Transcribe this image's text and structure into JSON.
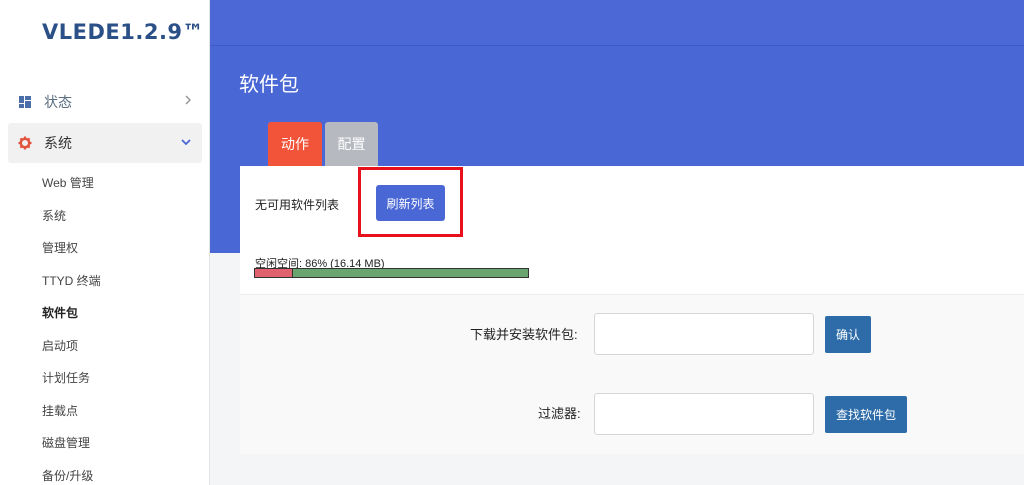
{
  "brand": "VLEDE1.2.9™",
  "sidebar": {
    "items": [
      {
        "label": "状态",
        "icon": "dashboard-icon"
      },
      {
        "label": "系统",
        "icon": "gear-icon"
      }
    ],
    "sub_items": [
      "Web 管理",
      "系统",
      "管理权",
      "TTYD 终端",
      "软件包",
      "启动项",
      "计划任务",
      "挂载点",
      "磁盘管理",
      "备份/升级"
    ],
    "active_sub": "软件包"
  },
  "page": {
    "title": "软件包",
    "tabs": [
      "动作",
      "配置"
    ]
  },
  "actions": {
    "no_packages": "无可用软件列表",
    "refresh_label": "刷新列表",
    "free_space": "空闲空间: 86% (16.14 MB)",
    "free_percent": 86,
    "download_label": "下载并安装软件包:",
    "download_value": "",
    "confirm_label": "确认",
    "filter_label": "过滤器:",
    "filter_value": "",
    "find_label": "查找软件包"
  },
  "colors": {
    "header": "#4a67d6",
    "active_tab": "#f2543a",
    "highlight": "#e8101a"
  }
}
